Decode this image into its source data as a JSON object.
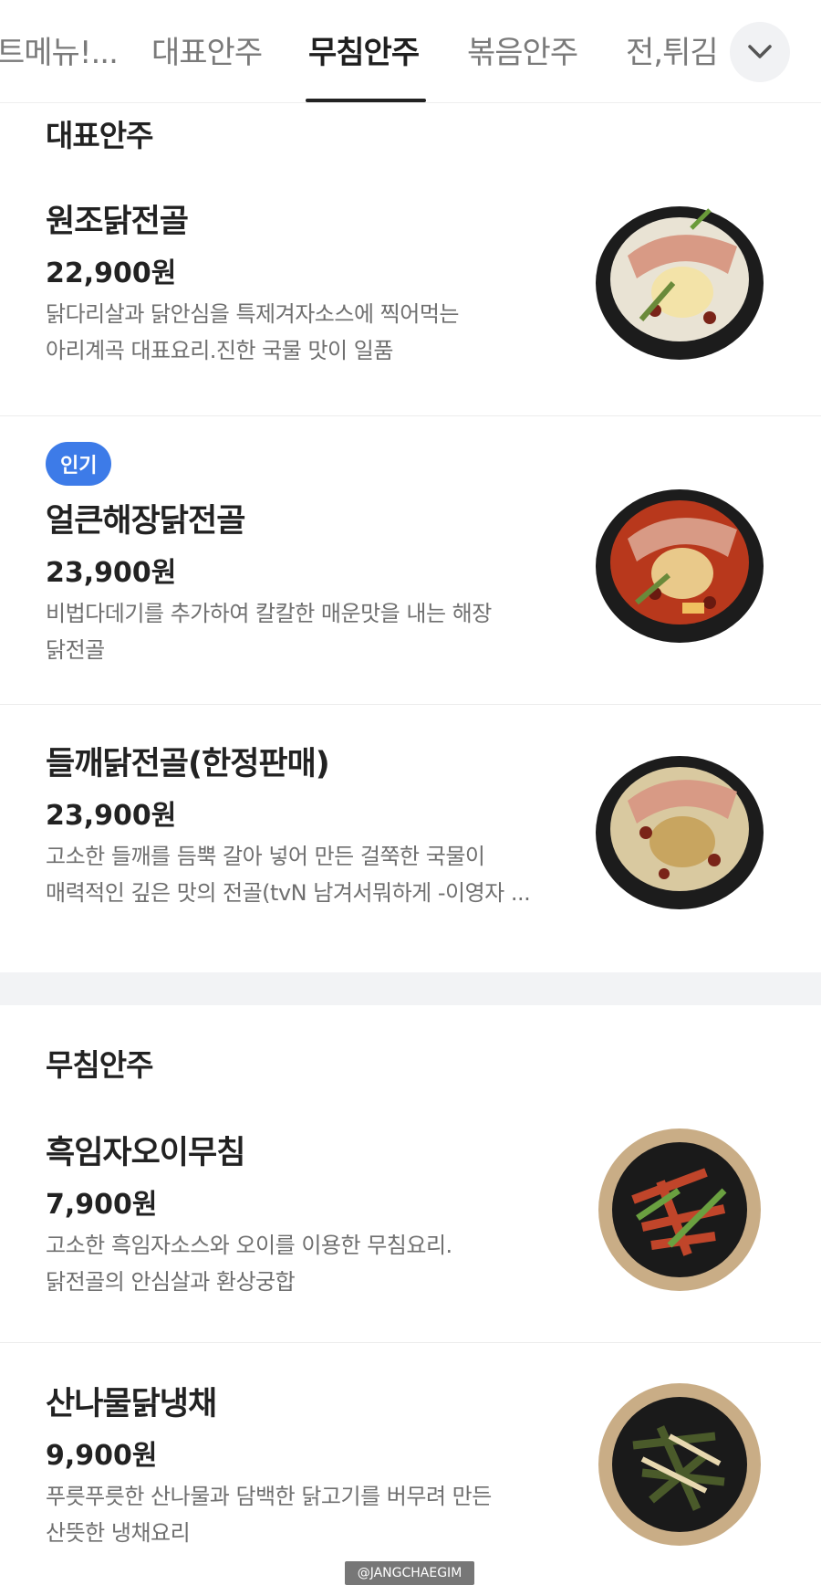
{
  "tabs": [
    {
      "label": "트메뉴!..."
    },
    {
      "label": "대표안주"
    },
    {
      "label": "무침안주"
    },
    {
      "label": "볶음안주"
    },
    {
      "label": "전,튀김"
    }
  ],
  "active_tab": "무침안주",
  "sections": [
    {
      "title": "대표안주",
      "items": [
        {
          "name": "원조닭전골",
          "price": "22,900원",
          "desc": [
            "닭다리살과 닭안심을 특제겨자소스에 찍어먹는",
            "아리계곡 대표요리.진한 국물 맛이 일품"
          ],
          "image": "chicken-hotpot-image"
        },
        {
          "badge": "인기",
          "name": "얼큰해장닭전골",
          "price": "23,900원",
          "desc": [
            "비법다데기를 추가하여 칼칼한 매운맛을 내는 해장",
            "닭전골"
          ],
          "image": "spicy-chicken-hotpot-image"
        },
        {
          "name": "들깨닭전골(한정판매)",
          "price": "23,900원",
          "desc": [
            "고소한 들깨를 듬뿍 갈아 넣어 만든 걸쭉한 국물이",
            "매력적인 깊은 맛의 전골(tvN 남겨서뭐하게 -이영자 ..."
          ],
          "image": "perilla-chicken-hotpot-image"
        }
      ]
    },
    {
      "title": "무침안주",
      "items": [
        {
          "name": "흑임자오이무침",
          "price": "7,900원",
          "desc": [
            "고소한 흑임자소스와 오이를 이용한 무침요리.",
            "닭전골의 안심살과 환상궁합"
          ],
          "image": "cucumber-salad-image"
        },
        {
          "name": "산나물닭냉채",
          "price": "9,900원",
          "desc": [
            "푸릇푸릇한 산나물과 담백한 닭고기를 버무려 만든",
            "산뜻한 냉채요리"
          ],
          "image": "wild-greens-chicken-salad-image"
        }
      ]
    }
  ],
  "watermark": "@JANGCHAEGIM",
  "colors": {
    "badge": "#3d7be8",
    "accent_underline": "#222222",
    "section_gap": "#f2f3f5"
  }
}
